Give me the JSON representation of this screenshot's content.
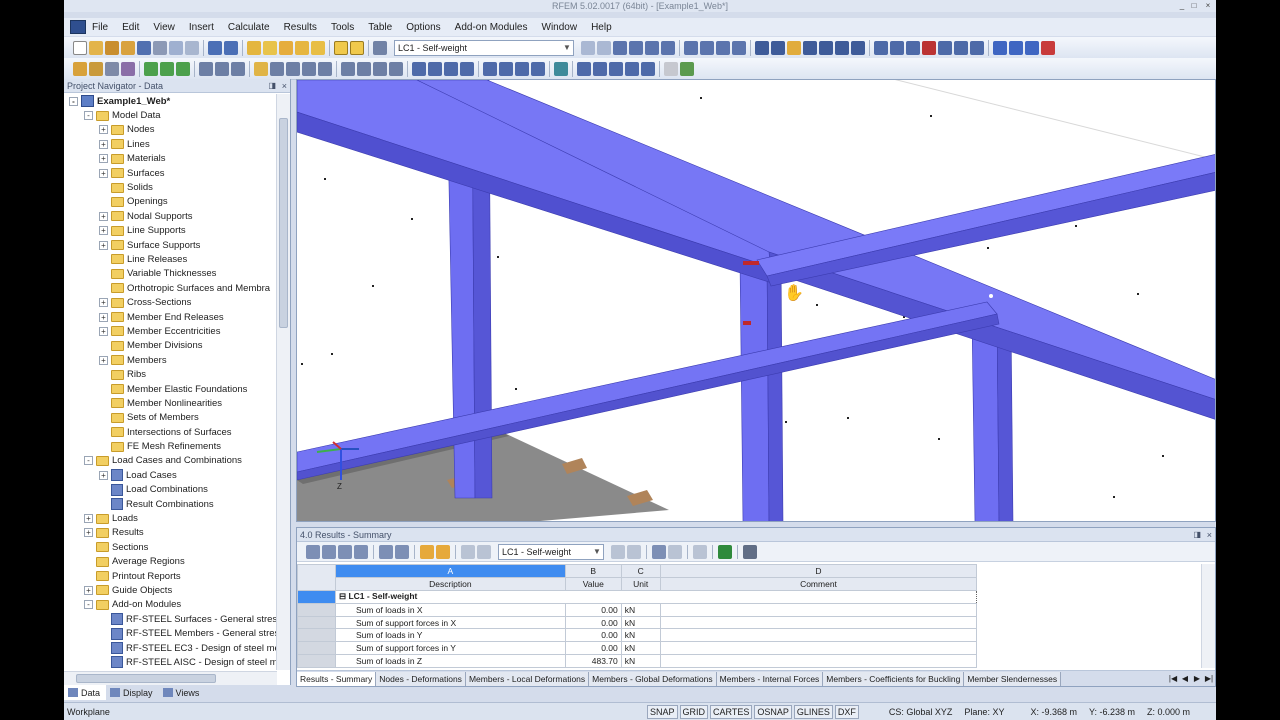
{
  "window": {
    "title": "RFEM 5.02.0017 (64bit) - [Example1_Web*]",
    "controls": [
      "_",
      "□",
      "×"
    ]
  },
  "menu": [
    "File",
    "Edit",
    "View",
    "Insert",
    "Calculate",
    "Results",
    "Tools",
    "Table",
    "Options",
    "Add-on Modules",
    "Window",
    "Help"
  ],
  "toolbar": {
    "load_case": "LC1 - Self-weight"
  },
  "navigator": {
    "title": "Project Navigator - Data",
    "root": "Example1_Web*",
    "items": [
      {
        "label": "Model Data",
        "level": 1,
        "expander": "-",
        "icon": "folder"
      },
      {
        "label": "Nodes",
        "level": 2,
        "expander": "+",
        "icon": "folder"
      },
      {
        "label": "Lines",
        "level": 2,
        "expander": "+",
        "icon": "folder"
      },
      {
        "label": "Materials",
        "level": 2,
        "expander": "+",
        "icon": "folder"
      },
      {
        "label": "Surfaces",
        "level": 2,
        "expander": "+",
        "icon": "folder"
      },
      {
        "label": "Solids",
        "level": 2,
        "expander": "",
        "icon": "folder"
      },
      {
        "label": "Openings",
        "level": 2,
        "expander": "",
        "icon": "folder"
      },
      {
        "label": "Nodal Supports",
        "level": 2,
        "expander": "+",
        "icon": "folder"
      },
      {
        "label": "Line Supports",
        "level": 2,
        "expander": "+",
        "icon": "folder"
      },
      {
        "label": "Surface Supports",
        "level": 2,
        "expander": "+",
        "icon": "folder"
      },
      {
        "label": "Line Releases",
        "level": 2,
        "expander": "",
        "icon": "folder"
      },
      {
        "label": "Variable Thicknesses",
        "level": 2,
        "expander": "",
        "icon": "folder"
      },
      {
        "label": "Orthotropic Surfaces and Membra",
        "level": 2,
        "expander": "",
        "icon": "folder"
      },
      {
        "label": "Cross-Sections",
        "level": 2,
        "expander": "+",
        "icon": "folder"
      },
      {
        "label": "Member End Releases",
        "level": 2,
        "expander": "+",
        "icon": "folder"
      },
      {
        "label": "Member Eccentricities",
        "level": 2,
        "expander": "+",
        "icon": "folder"
      },
      {
        "label": "Member Divisions",
        "level": 2,
        "expander": "",
        "icon": "folder"
      },
      {
        "label": "Members",
        "level": 2,
        "expander": "+",
        "icon": "folder"
      },
      {
        "label": "Ribs",
        "level": 2,
        "expander": "",
        "icon": "folder"
      },
      {
        "label": "Member Elastic Foundations",
        "level": 2,
        "expander": "",
        "icon": "folder"
      },
      {
        "label": "Member Nonlinearities",
        "level": 2,
        "expander": "",
        "icon": "folder"
      },
      {
        "label": "Sets of Members",
        "level": 2,
        "expander": "",
        "icon": "folder"
      },
      {
        "label": "Intersections of Surfaces",
        "level": 2,
        "expander": "",
        "icon": "folder"
      },
      {
        "label": "FE Mesh Refinements",
        "level": 2,
        "expander": "",
        "icon": "folder"
      },
      {
        "label": "Load Cases and Combinations",
        "level": 1,
        "expander": "-",
        "icon": "folder"
      },
      {
        "label": "Load Cases",
        "level": 2,
        "expander": "+",
        "icon": "doc"
      },
      {
        "label": "Load Combinations",
        "level": 2,
        "expander": "",
        "icon": "doc"
      },
      {
        "label": "Result Combinations",
        "level": 2,
        "expander": "",
        "icon": "doc"
      },
      {
        "label": "Loads",
        "level": 1,
        "expander": "+",
        "icon": "folder"
      },
      {
        "label": "Results",
        "level": 1,
        "expander": "+",
        "icon": "folder"
      },
      {
        "label": "Sections",
        "level": 1,
        "expander": "",
        "icon": "folder"
      },
      {
        "label": "Average Regions",
        "level": 1,
        "expander": "",
        "icon": "folder"
      },
      {
        "label": "Printout Reports",
        "level": 1,
        "expander": "",
        "icon": "folder"
      },
      {
        "label": "Guide Objects",
        "level": 1,
        "expander": "+",
        "icon": "folder"
      },
      {
        "label": "Add-on Modules",
        "level": 1,
        "expander": "-",
        "icon": "folder"
      },
      {
        "label": "RF-STEEL Surfaces - General stress",
        "level": 2,
        "expander": "",
        "icon": "doc"
      },
      {
        "label": "RF-STEEL Members - General stres",
        "level": 2,
        "expander": "",
        "icon": "doc"
      },
      {
        "label": "RF-STEEL EC3 - Design of steel me",
        "level": 2,
        "expander": "",
        "icon": "doc"
      },
      {
        "label": "RF-STEEL AISC - Design of steel m",
        "level": 2,
        "expander": "",
        "icon": "doc"
      }
    ],
    "tabs": [
      "Data",
      "Display",
      "Views"
    ]
  },
  "results": {
    "title": "4.0 Results - Summary",
    "load_case": "LC1 - Self-weight",
    "columns": [
      {
        "letter": "A",
        "name": "Description"
      },
      {
        "letter": "B",
        "name": "Value"
      },
      {
        "letter": "C",
        "name": "Unit"
      },
      {
        "letter": "D",
        "name": "Comment"
      }
    ],
    "group": "LC1 - Self-weight",
    "rows": [
      {
        "desc": "Sum of loads in X",
        "value": "0.00",
        "unit": "kN"
      },
      {
        "desc": "Sum of support forces in X",
        "value": "0.00",
        "unit": "kN"
      },
      {
        "desc": "Sum of loads in Y",
        "value": "0.00",
        "unit": "kN"
      },
      {
        "desc": "Sum of support forces in Y",
        "value": "0.00",
        "unit": "kN"
      },
      {
        "desc": "Sum of loads in Z",
        "value": "483.70",
        "unit": "kN"
      }
    ],
    "tabs": [
      "Results - Summary",
      "Nodes - Deformations",
      "Members - Local Deformations",
      "Members - Global Deformations",
      "Members - Internal Forces",
      "Members - Coefficients for Buckling",
      "Member Slendernesses"
    ]
  },
  "statusbar": {
    "left": "Workplane",
    "toggles": [
      "SNAP",
      "GRID",
      "CARTES",
      "OSNAP",
      "GLINES",
      "DXF"
    ],
    "cs": "CS: Global XYZ",
    "plane": "Plane: XY",
    "x": "X: -9.368 m",
    "y": "Y: -6.238 m",
    "z": "Z: 0.000 m"
  },
  "viewport": {
    "axis_label": "Z",
    "member_color": "#6e6ef2"
  }
}
